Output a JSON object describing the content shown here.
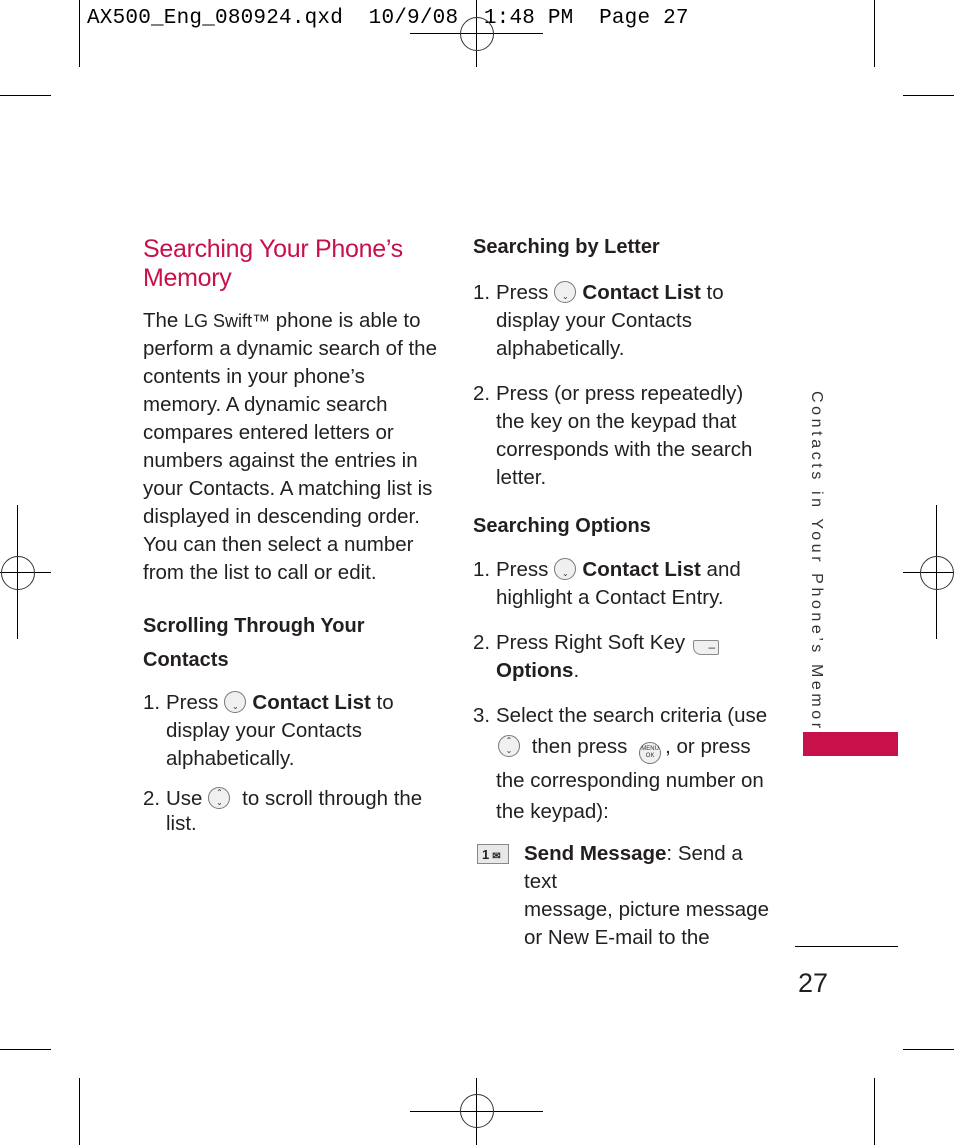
{
  "slug": {
    "text": "AX500_Eng_080924.qxd  10/9/08  1:48 PM  Page 27"
  },
  "left_column": {
    "title": "Searching Your Phone’s Memory",
    "title_line1": "Searching Your Phone’s",
    "title_line2": "Memory",
    "intro_pre": "The ",
    "brand": "LG Swift™",
    "intro_lines": [
      " phone is able to",
      "perform a dynamic search of the",
      "contents in your phone’s",
      "memory. A dynamic search",
      "compares entered letters or",
      "numbers against the entries in",
      "your Contacts. A matching list is",
      "displayed in descending order.",
      "You can then select a number",
      "from the list to call or edit."
    ],
    "scrolling": {
      "heading_line1": "Scrolling Through Your",
      "heading_line2": "Contacts",
      "steps": [
        {
          "num": "1.",
          "pre": "Press",
          "icon": "down-key-icon",
          "bold": "Contact List",
          "post": " to",
          "rest": [
            "display your Contacts",
            "alphabetically."
          ]
        },
        {
          "num": "2.",
          "pre": "Use",
          "icon": "navigation-key-icon",
          "post": " to scroll through the",
          "rest": [
            "list."
          ]
        }
      ]
    }
  },
  "right_column": {
    "by_letter": {
      "heading": "Searching by Letter",
      "steps": [
        {
          "num": "1.",
          "pre": "Press",
          "icon": "down-key-icon",
          "bold": "Contact List",
          "post": " to",
          "rest": [
            "display your Contacts",
            "alphabetically."
          ]
        },
        {
          "num": "2.",
          "lines": [
            "Press (or press repeatedly)",
            "the key on the keypad that",
            "corresponds with the search",
            "letter."
          ]
        }
      ]
    },
    "options": {
      "heading": "Searching Options",
      "steps": [
        {
          "num": "1.",
          "pre": "Press",
          "icon": "down-key-icon",
          "bold": "Contact List",
          "post": " and",
          "rest": [
            "highlight a Contact Entry."
          ]
        },
        {
          "num": "2.",
          "pre": "Press Right Soft Key",
          "icon": "right-soft-key-icon",
          "bold_line": "Options",
          "bold_suffix": "."
        },
        {
          "num": "3.",
          "line1": "Select the search criteria (use",
          "then_press": " then press ",
          "after_ok": ", or press",
          "rest": [
            "the corresponding number on",
            "the keypad):"
          ]
        }
      ],
      "items": [
        {
          "key_label": "1",
          "bold": "Send Message",
          "text": ": Send a text",
          "rest": [
            "message, picture message",
            "or New E-mail to the"
          ]
        }
      ]
    }
  },
  "icons": {
    "ok_key_top": "MENU",
    "ok_key_bottom": "OK",
    "soft_key_glyph": "–"
  },
  "side_tab": {
    "text": "Contacts in Your Phone’s Memory",
    "color": "#c8104a"
  },
  "page_number": "27",
  "colors": {
    "heading": "#c8104a",
    "body_text": "#231f20"
  }
}
